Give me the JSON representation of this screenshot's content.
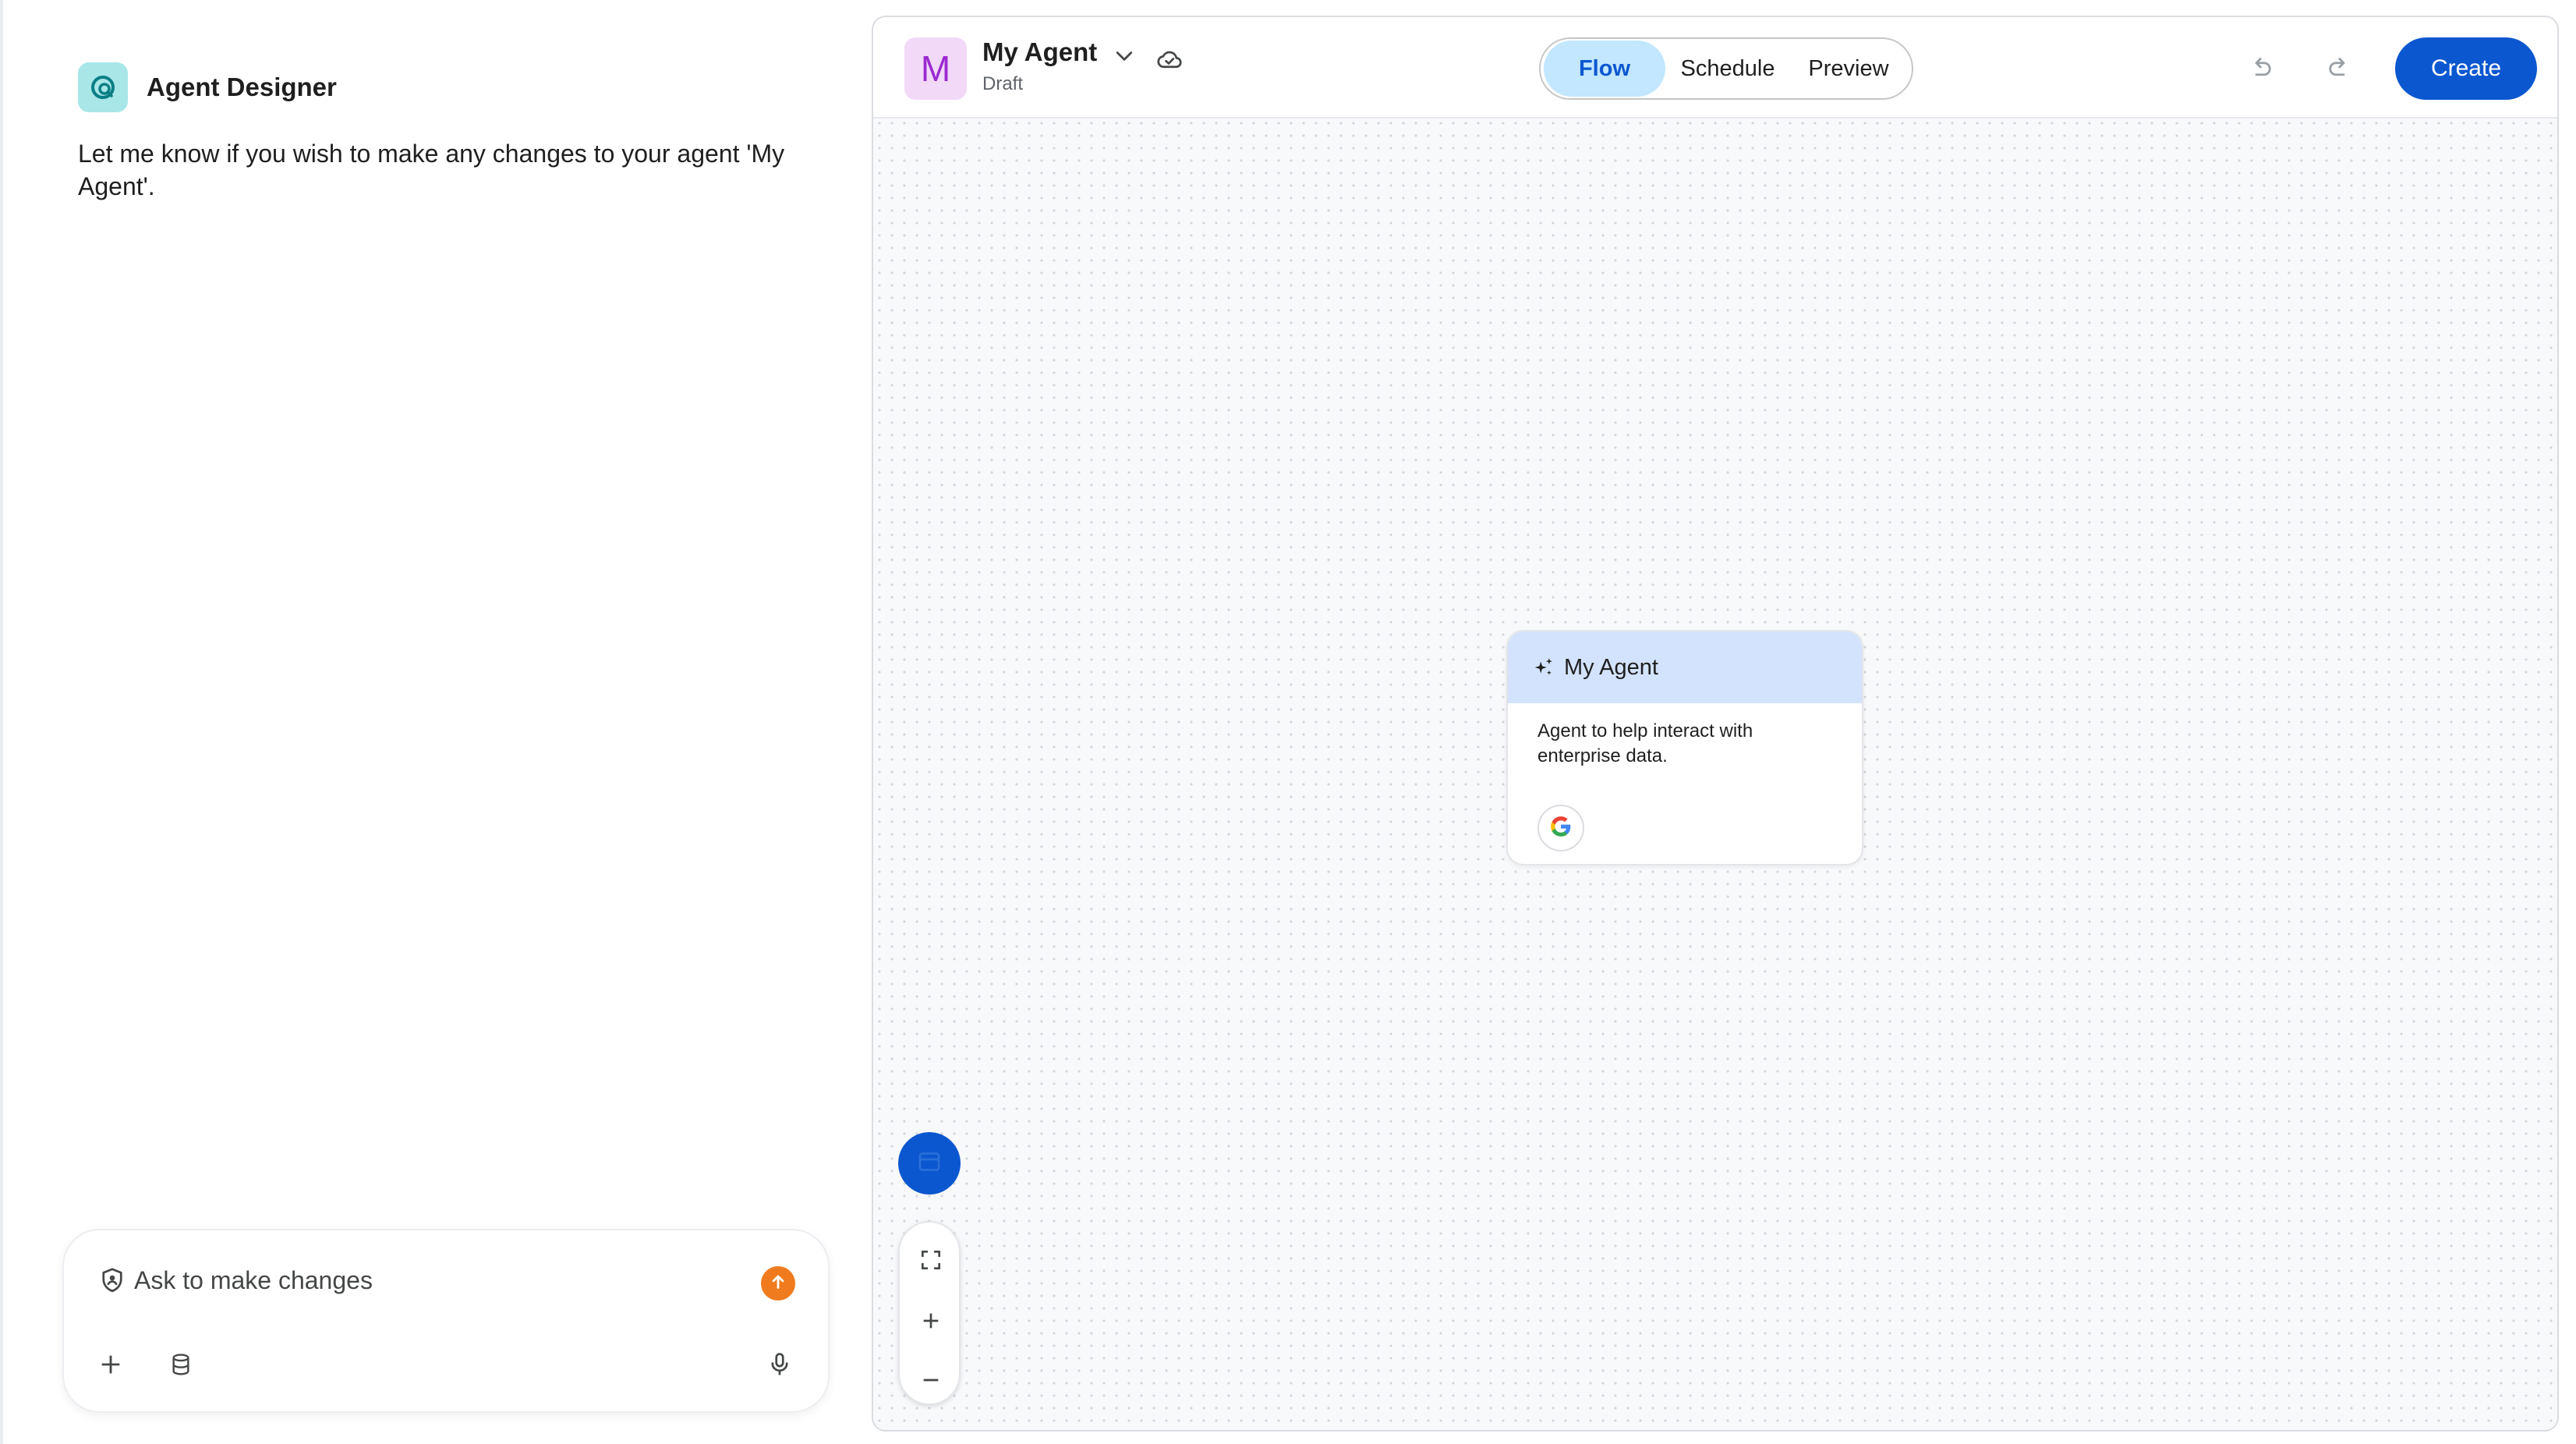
{
  "designer": {
    "title": "Agent Designer",
    "message": "Let me know if you wish to make any changes to your agent 'My Agent'."
  },
  "composer": {
    "placeholder": "Ask to make changes",
    "icons": [
      "shield-icon",
      "send-icon",
      "add-icon",
      "database-icon",
      "mic-icon"
    ]
  },
  "toolbar": {
    "avatar_letter": "M",
    "agent_name": "My Agent",
    "agent_status": "Draft",
    "tabs": [
      {
        "label": "Flow",
        "active": true
      },
      {
        "label": "Schedule",
        "active": false
      },
      {
        "label": "Preview",
        "active": false
      }
    ],
    "create_label": "Create"
  },
  "node": {
    "title": "My Agent",
    "description": "Agent to help interact with enterprise data.",
    "tool_icon": "google-icon"
  },
  "colors": {
    "accent": "#0b57d0",
    "tab_active_bg": "#c2e7ff",
    "node_header_bg": "#d3e3fd",
    "send_button": "#f07b1e",
    "avatar_bg": "#f2d9f8",
    "avatar_fg": "#9a2bd0",
    "designer_logo_bg": "#a8e6e7"
  }
}
